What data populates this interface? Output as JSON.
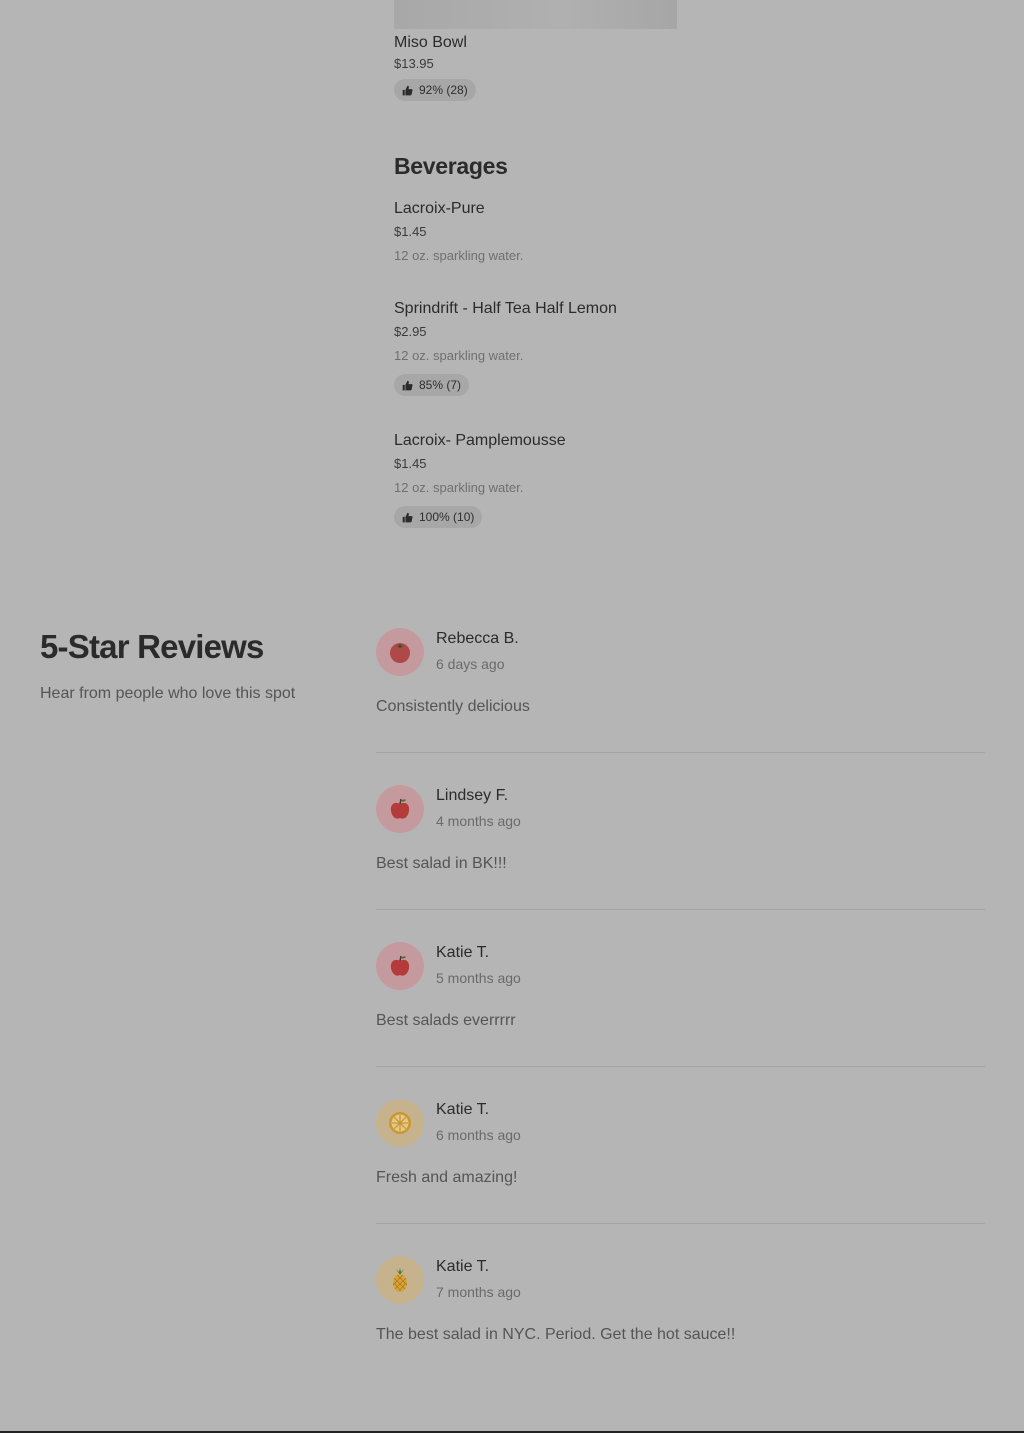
{
  "menu": {
    "miso_bowl": {
      "name": "Miso Bowl",
      "price": "$13.95",
      "rating": "92% (28)"
    },
    "beverages": {
      "title": "Beverages",
      "items": [
        {
          "name": "Lacroix-Pure",
          "price": "$1.45",
          "description": "12 oz. sparkling water."
        },
        {
          "name": "Sprindrift - Half Tea Half Lemon",
          "price": "$2.95",
          "description": "12 oz. sparkling water.",
          "rating": "85% (7)"
        },
        {
          "name": "Lacroix- Pamplemousse",
          "price": "$1.45",
          "description": "12 oz. sparkling water.",
          "rating": "100% (10)"
        }
      ]
    }
  },
  "reviews": {
    "heading": "5-Star Reviews",
    "subheading": "Hear from people who love this spot",
    "items": [
      {
        "name": "Rebecca B.",
        "date": "6 days ago",
        "text": "Consistently delicious",
        "avatar_icon": "tomato-icon",
        "avatar_bg": "#c59a9f"
      },
      {
        "name": "Lindsey F.",
        "date": "4 months ago",
        "text": "Best salad in BK!!!",
        "avatar_icon": "apple-icon",
        "avatar_bg": "#c59a9f"
      },
      {
        "name": "Katie T.",
        "date": "5 months ago",
        "text": "Best salads everrrrr",
        "avatar_icon": "apple-icon",
        "avatar_bg": "#c59a9f"
      },
      {
        "name": "Katie T.",
        "date": "6 months ago",
        "text": "Fresh and amazing!",
        "avatar_icon": "orange-slice-icon",
        "avatar_bg": "#c6b38e"
      },
      {
        "name": "Katie T.",
        "date": "7 months ago",
        "text": "The best salad in NYC. Period. Get the hot sauce!!",
        "avatar_icon": "pineapple-icon",
        "avatar_bg": "#c6b38e"
      }
    ]
  }
}
